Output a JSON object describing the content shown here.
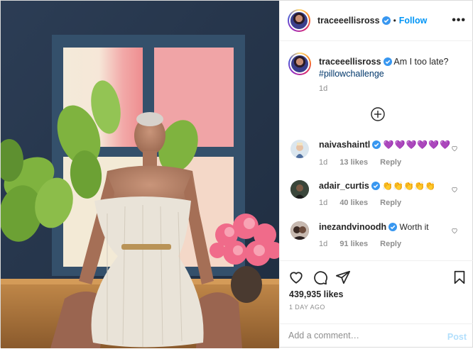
{
  "header": {
    "username": "traceeellisross",
    "separator": "•",
    "follow_label": "Follow",
    "more_icon": "more-horizontal-icon"
  },
  "caption": {
    "username": "traceeellisross",
    "text": "Am I too late?",
    "hashtag": "#pillowchallenge",
    "time": "1d"
  },
  "load_more_icon": "plus-circle-icon",
  "comments": [
    {
      "username": "naivashaintl",
      "text": "💜💜💜💜💜💜",
      "time": "1d",
      "likes": "13 likes",
      "reply": "Reply"
    },
    {
      "username": "adair_curtis",
      "text": "👏👏👏👏👏",
      "time": "1d",
      "likes": "40 likes",
      "reply": "Reply"
    },
    {
      "username": "inezandvinoodh",
      "text": "Worth it",
      "time": "1d",
      "likes": "91 likes",
      "reply": "Reply"
    }
  ],
  "actions": {
    "like_icon": "heart-icon",
    "comment_icon": "comment-icon",
    "share_icon": "share-icon",
    "save_icon": "bookmark-icon"
  },
  "likes": "439,935 likes",
  "date": "1 DAY AGO",
  "add_comment": {
    "placeholder": "Add a comment…",
    "post_label": "Post"
  },
  "colors": {
    "link_blue": "#0095f6",
    "hashtag": "#00376b",
    "muted": "#8e8e8e",
    "post_disabled": "#b2dffc"
  }
}
